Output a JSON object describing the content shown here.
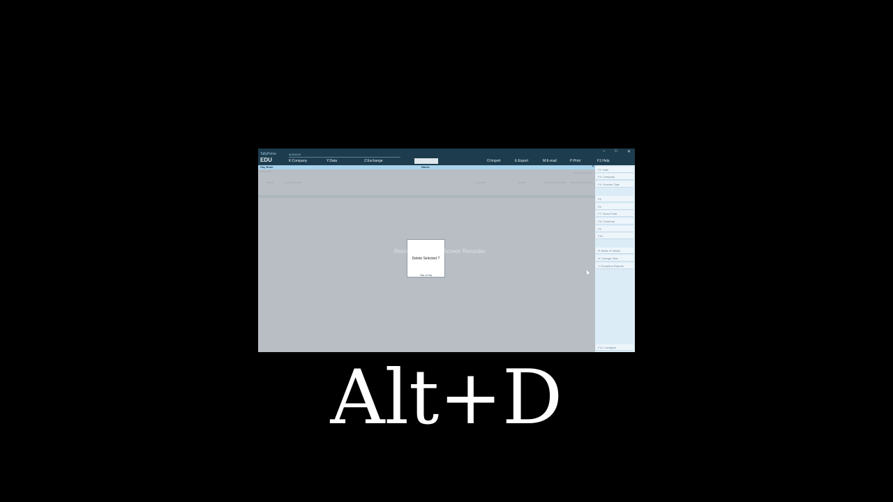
{
  "app": {
    "brand_top": "TallyPrime",
    "brand_edu": "EDU",
    "manage_label": "MANAGE"
  },
  "menu": {
    "company": "K:Company",
    "data": "Y:Data",
    "exchange": "Z:Exchange",
    "import": "O:Import",
    "export": "E:Export",
    "email": "M:E-mail",
    "print": "P:Print",
    "help": "F1:Help"
  },
  "window_controls": {
    "minimize": "–",
    "maximize": "□",
    "close": "✕"
  },
  "subbar": {
    "report_title": "Day Book",
    "company_name": "Harris",
    "close_glyph": "✕"
  },
  "right_panel": {
    "buttons": [
      "F2: Date",
      "F3: Company",
      "F4: Voucher Type",
      "F5",
      "F6",
      "F7: Show Profit",
      "F8: Columnar",
      "F9",
      "F10",
      "B: Basis of Values",
      "H: Change View",
      "J: Exception Reports"
    ],
    "configure": "F12: Configure"
  },
  "dialog": {
    "question": "Delete Selected ?",
    "options": "Yes or No"
  },
  "overlay": {
    "watermark": "Recorded with iTop Screen Recorder",
    "shortcut": "Alt+D"
  }
}
